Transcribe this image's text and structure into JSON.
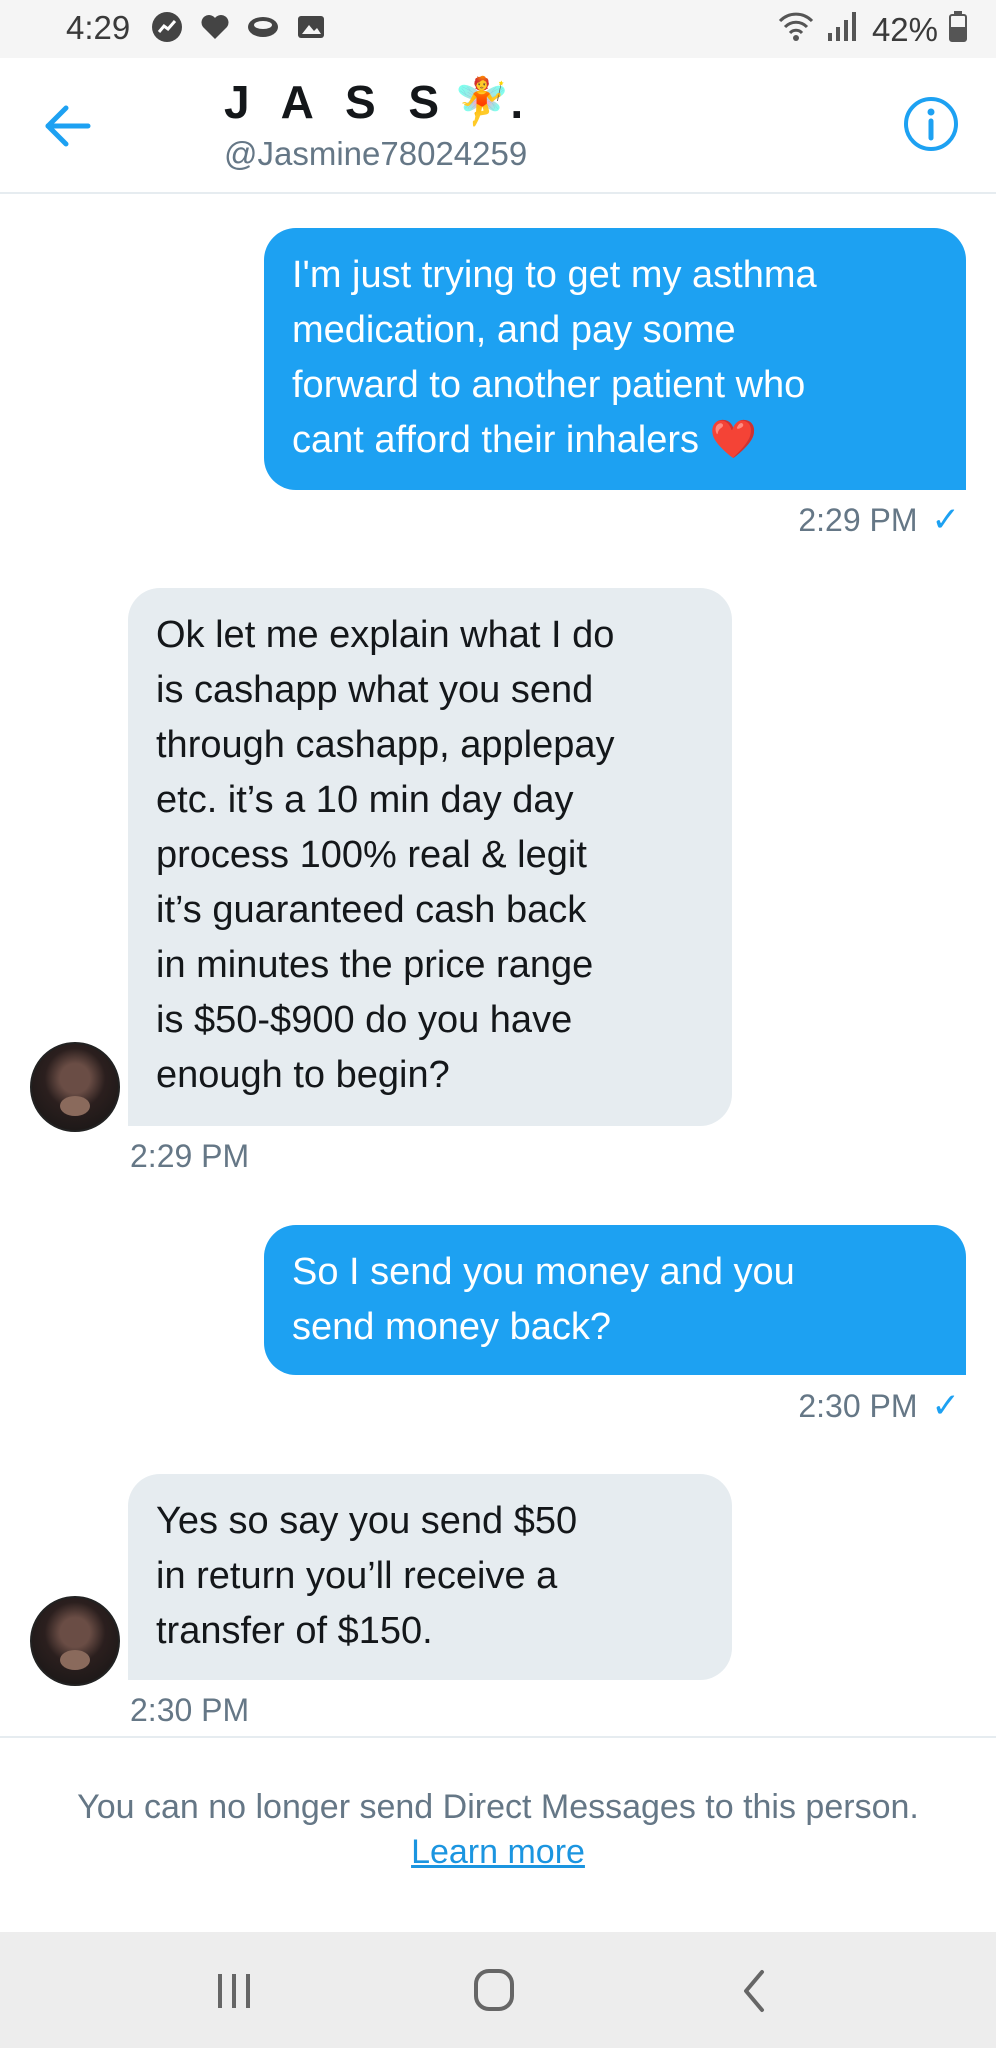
{
  "status_bar": {
    "time": "4:29",
    "battery": "42%",
    "icons_left": [
      "trending-icon",
      "heart-icon",
      "cloud-icon",
      "gallery-icon"
    ],
    "icons_right": [
      "wifi-icon",
      "signal-icon",
      "battery-icon"
    ]
  },
  "header": {
    "title": "J A S S",
    "title_emoji": "🧚",
    "title_suffix": ".",
    "handle": "@Jasmine78024259"
  },
  "messages": [
    {
      "direction": "out",
      "lines": [
        "I'm just trying to get my asthma",
        "medication, and pay some",
        "forward to another patient who",
        "cant afford their inhalers ❤️"
      ],
      "time": "2:29 PM",
      "read_mark": "✓"
    },
    {
      "direction": "in",
      "lines": [
        "Ok let me explain what I do",
        "is cashapp what you send",
        "through cashapp, applepay",
        "etc. it’s a 10 min day day",
        "process 100% real & legit",
        "it’s guaranteed cash back",
        "in minutes the price range",
        "is $50-$900 do you have",
        "enough to begin?"
      ],
      "time": "2:29 PM"
    },
    {
      "direction": "out",
      "lines": [
        "So I send you money and you",
        "send money back?"
      ],
      "time": "2:30 PM",
      "read_mark": "✓"
    },
    {
      "direction": "in",
      "lines": [
        "Yes so say you send $50",
        "in return you’ll receive a",
        "transfer of $150."
      ],
      "time": "2:30 PM"
    }
  ],
  "footer": {
    "notice": "You can no longer send Direct Messages to this person.",
    "link": "Learn more"
  },
  "colors": {
    "accent": "#1da1f2",
    "incoming_bubble": "#e6ecf0",
    "muted_text": "#657786"
  }
}
